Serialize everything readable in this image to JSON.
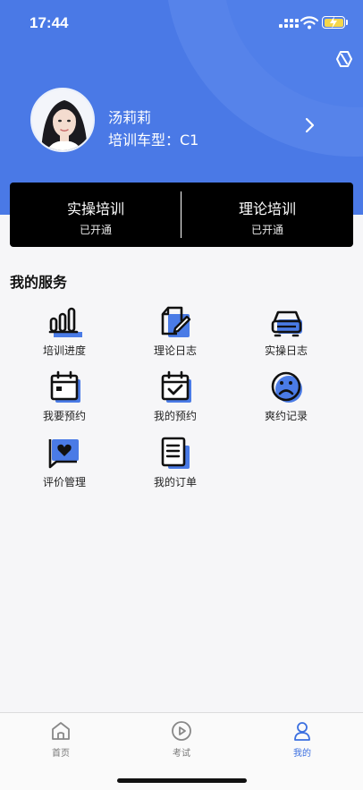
{
  "status_bar": {
    "time": "17:44"
  },
  "profile": {
    "name": "汤莉莉",
    "car_type": "培训车型：C1"
  },
  "training": [
    {
      "title": "实操培训",
      "status": "已开通"
    },
    {
      "title": "理论培训",
      "status": "已开通"
    }
  ],
  "services": {
    "title": "我的服务",
    "items": [
      {
        "label": "培训进度",
        "icon": "bar-chart-icon"
      },
      {
        "label": "理论日志",
        "icon": "note-edit-icon"
      },
      {
        "label": "实操日志",
        "icon": "car-icon"
      },
      {
        "label": "我要预约",
        "icon": "calendar-icon"
      },
      {
        "label": "我的预约",
        "icon": "calendar-check-icon"
      },
      {
        "label": "爽约记录",
        "icon": "sad-face-icon"
      },
      {
        "label": "评价管理",
        "icon": "heart-message-icon"
      },
      {
        "label": "我的订单",
        "icon": "document-icon"
      }
    ]
  },
  "tabbar": {
    "tabs": [
      {
        "label": "首页",
        "icon": "home-icon"
      },
      {
        "label": "考试",
        "icon": "play-circle-icon"
      },
      {
        "label": "我的",
        "icon": "user-icon"
      }
    ],
    "active": "我的"
  },
  "colors": {
    "header": "#4a79e6",
    "accent": "#3b6fe0",
    "icon_fill": "#4a7be6"
  }
}
